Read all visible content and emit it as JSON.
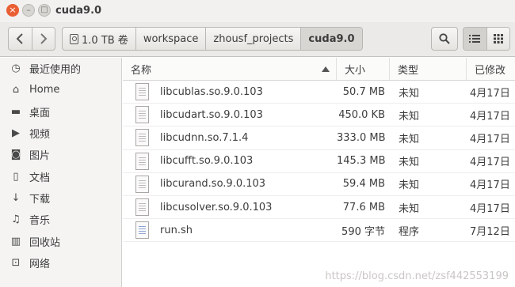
{
  "window": {
    "title": "cuda9.0"
  },
  "toolbar": {
    "back_label": "‹",
    "forward_label": "›",
    "breadcrumbs": [
      "1.0 TB 卷",
      "workspace",
      "zhousf_projects",
      "cuda9.0"
    ]
  },
  "sidebar": {
    "items": [
      {
        "label": "最近使用的",
        "icon": "clock-icon"
      },
      {
        "label": "Home",
        "icon": "home-icon"
      },
      {
        "label": "桌面",
        "icon": "desktop-icon"
      },
      {
        "label": "视频",
        "icon": "video-icon"
      },
      {
        "label": "图片",
        "icon": "camera-icon"
      },
      {
        "label": "文档",
        "icon": "document-icon"
      },
      {
        "label": "下载",
        "icon": "download-icon"
      },
      {
        "label": "音乐",
        "icon": "music-icon"
      },
      {
        "label": "回收站",
        "icon": "trash-icon"
      },
      {
        "label": "网络",
        "icon": "network-icon"
      }
    ]
  },
  "columns": {
    "name": "名称",
    "size": "大小",
    "type": "类型",
    "modified": "已修改"
  },
  "files": [
    {
      "name": "libcublas.so.9.0.103",
      "size": "50.7 MB",
      "type": "未知",
      "modified": "4月17日"
    },
    {
      "name": "libcudart.so.9.0.103",
      "size": "450.0 KB",
      "type": "未知",
      "modified": "4月17日"
    },
    {
      "name": "libcudnn.so.7.1.4",
      "size": "333.0 MB",
      "type": "未知",
      "modified": "4月17日"
    },
    {
      "name": "libcufft.so.9.0.103",
      "size": "145.3 MB",
      "type": "未知",
      "modified": "4月17日"
    },
    {
      "name": "libcurand.so.9.0.103",
      "size": "59.4 MB",
      "type": "未知",
      "modified": "4月17日"
    },
    {
      "name": "libcusolver.so.9.0.103",
      "size": "77.6 MB",
      "type": "未知",
      "modified": "4月17日"
    },
    {
      "name": "run.sh",
      "size": "590 字节",
      "type": "程序",
      "modified": "7月12日"
    }
  ],
  "watermark": "https://blog.csdn.net/zsf442553199"
}
